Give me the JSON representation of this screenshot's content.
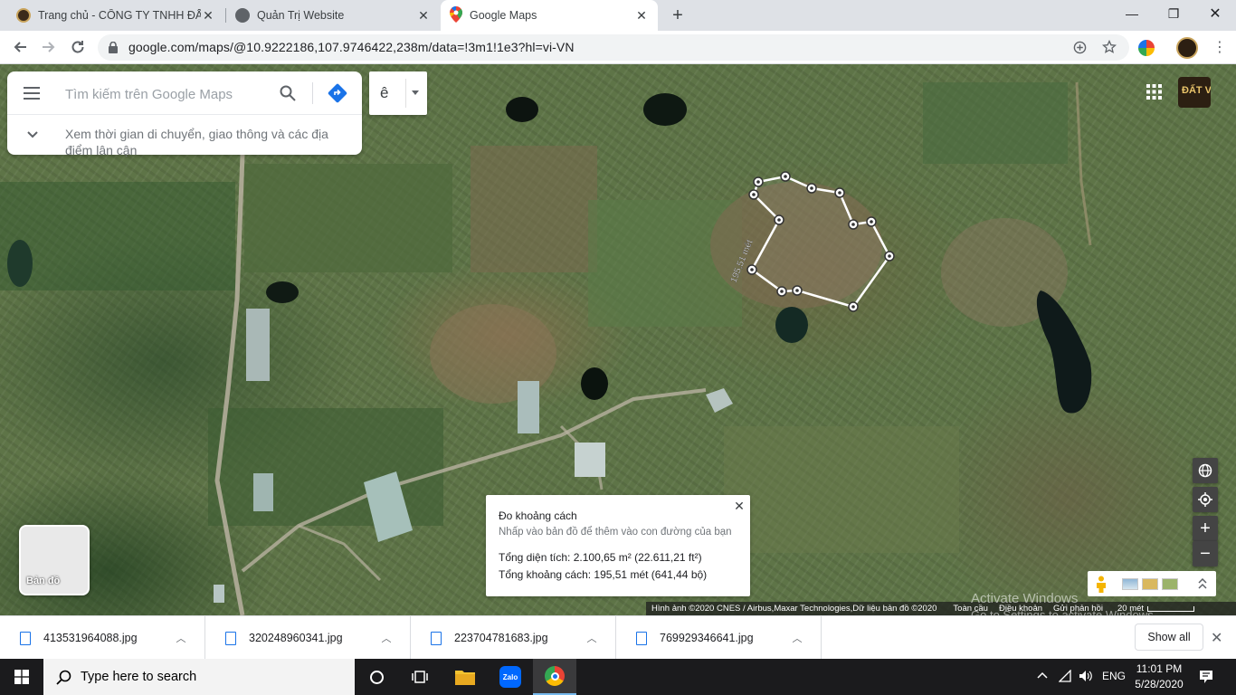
{
  "browser": {
    "tabs": [
      {
        "title": "Trang chủ - CÔNG TY TNHH ĐẤT",
        "close": "✕"
      },
      {
        "title": "Quản Trị Website",
        "close": "✕"
      },
      {
        "title": "Google Maps",
        "close": "✕"
      }
    ],
    "new_tab": "+",
    "window": {
      "minimize": "—",
      "maximize": "❐",
      "close": "✕"
    },
    "url": "google.com/maps/@10.9222186,107.9746422,238m/data=!3m1!1e3?hl=vi-VN"
  },
  "maps": {
    "search_placeholder": "Tìm kiếm trên Google Maps",
    "explore_text": "Xem thời gian di chuyển, giao thông và các địa điểm lân cận",
    "layer_letter": "ê",
    "measure": {
      "title": "Đo khoảng cách",
      "hint": "Nhấp vào bản đồ để thêm vào con đường của bạn",
      "area": "Tổng diện tích: 2.100,65 m² (22.611,21 ft²)",
      "distance": "Tổng khoảng cách: 195,51 mét (641,44 bộ)",
      "close": "✕"
    },
    "path_label": "195,51 mét",
    "minimap_label": "Bản đồ",
    "brand_text": "ĐẤT V",
    "attribution": {
      "imagery": "Hình ảnh ©2020 CNES / Airbus,Maxar Technologies,Dữ liệu bản đồ ©2020",
      "global": "Toàn cầu",
      "terms": "Điều khoản",
      "feedback": "Gửi phản hồi",
      "scale": "20 mét"
    },
    "watermark": {
      "line1": "Activate Windows",
      "line2": "Go to Settings to activate Windows."
    },
    "zoom_in": "+",
    "zoom_out": "−"
  },
  "downloads": {
    "items": [
      {
        "name": "413531964088.jpg"
      },
      {
        "name": "320248960341.jpg"
      },
      {
        "name": "223704781683.jpg"
      },
      {
        "name": "769929346641.jpg"
      }
    ],
    "chevron": "︿",
    "show_all": "Show all",
    "close": "✕"
  },
  "taskbar": {
    "search_placeholder": "Type here to search",
    "zalo": "Zalo",
    "lang": "ENG",
    "time": "11:01 PM",
    "date": "5/28/2020"
  },
  "colors": {
    "map_accent": "#1a73e8",
    "tab_strip": "#dee1e6",
    "taskbar": "#1b1b1d"
  }
}
